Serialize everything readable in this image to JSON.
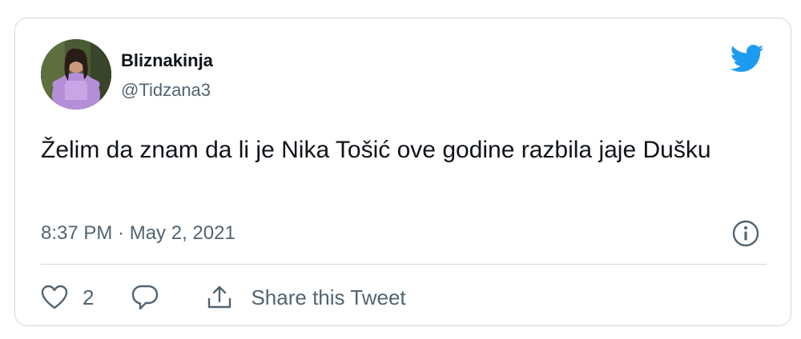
{
  "tweet": {
    "author": {
      "display_name": "Bliznakinja",
      "handle": "@Tidzana3",
      "avatar_icon": "profile-photo"
    },
    "text": "Želim da znam da li je Nika Tošić ove godine razbila jaje Dušku",
    "timestamp": "8:37 PM · May 2, 2021",
    "like_count": "2",
    "share_label": "Share this Tweet"
  },
  "icons": {
    "brand": "twitter-bird-icon",
    "info": "info-icon",
    "like": "heart-icon",
    "reply": "speech-bubble-icon",
    "share": "share-upload-icon"
  },
  "colors": {
    "brand_blue": "#1d9bf0",
    "text_primary": "#0f1419",
    "text_secondary": "#536471",
    "border": "#d3d9de"
  }
}
